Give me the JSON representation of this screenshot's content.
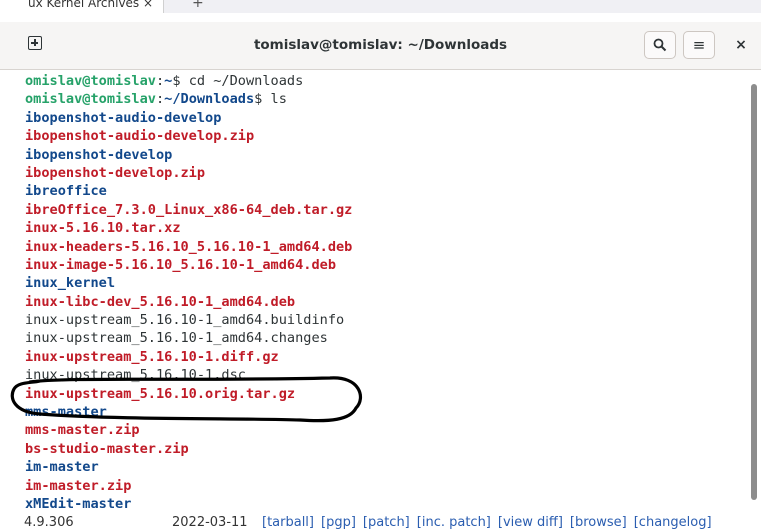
{
  "browser": {
    "tab_title": "ux Kernel Archives",
    "tab_close": "×",
    "new_tab": "+"
  },
  "terminal": {
    "title": "tomislav@tomislav: ~/Downloads",
    "new_tab_icon": "new-tab-icon",
    "search_icon_glyph": "🔍",
    "menu_icon_glyph": "≡",
    "close_glyph": "×",
    "lines": [
      {
        "type": "prompt",
        "user": "omislav@tomislav",
        "sep": ":",
        "path": "~",
        "tail": "$ cd ~/Downloads"
      },
      {
        "type": "prompt",
        "user": "omislav@tomislav",
        "sep": ":",
        "path": "~/Downloads",
        "tail": "$ ls"
      },
      {
        "type": "dir",
        "text": "ibopenshot-audio-develop"
      },
      {
        "type": "archive",
        "text": "ibopenshot-audio-develop.zip"
      },
      {
        "type": "dir",
        "text": "ibopenshot-develop"
      },
      {
        "type": "archive",
        "text": "ibopenshot-develop.zip"
      },
      {
        "type": "dir",
        "text": "ibreoffice"
      },
      {
        "type": "archive",
        "text": "ibreOffice_7.3.0_Linux_x86-64_deb.tar.gz"
      },
      {
        "type": "archive",
        "text": "inux-5.16.10.tar.xz"
      },
      {
        "type": "archive",
        "text": "inux-headers-5.16.10_5.16.10-1_amd64.deb"
      },
      {
        "type": "archive",
        "text": "inux-image-5.16.10_5.16.10-1_amd64.deb"
      },
      {
        "type": "dir",
        "text": "inux_kernel"
      },
      {
        "type": "archive",
        "text": "inux-libc-dev_5.16.10-1_amd64.deb"
      },
      {
        "type": "plain",
        "text": "inux-upstream_5.16.10-1_amd64.buildinfo"
      },
      {
        "type": "plain",
        "text": "inux-upstream_5.16.10-1_amd64.changes"
      },
      {
        "type": "archive",
        "text": "inux-upstream_5.16.10-1.diff.gz"
      },
      {
        "type": "plain",
        "text": "inux-upstream_5.16.10-1.dsc"
      },
      {
        "type": "archive",
        "text": "inux-upstream_5.16.10.orig.tar.gz"
      },
      {
        "type": "dir",
        "text": "mms-master"
      },
      {
        "type": "archive",
        "text": "mms-master.zip"
      },
      {
        "type": "archive",
        "text": "bs-studio-master.zip"
      },
      {
        "type": "dir",
        "text": "im-master"
      },
      {
        "type": "archive",
        "text": "im-master.zip"
      },
      {
        "type": "dir",
        "text": "xMEdit-master"
      }
    ],
    "colors": {
      "archive": "#c01c28",
      "directory": "#12488b",
      "prompt_user": "#26a269",
      "plain": "#2e3436",
      "annotation_stroke": "#000000"
    }
  },
  "bottom_row": {
    "version": "4.9.306",
    "date": "2022-03-11",
    "links": [
      "[tarball]",
      "[pgp]",
      "[patch]",
      "[inc. patch]",
      "[view diff]",
      "[browse]",
      "[changelog]"
    ]
  }
}
